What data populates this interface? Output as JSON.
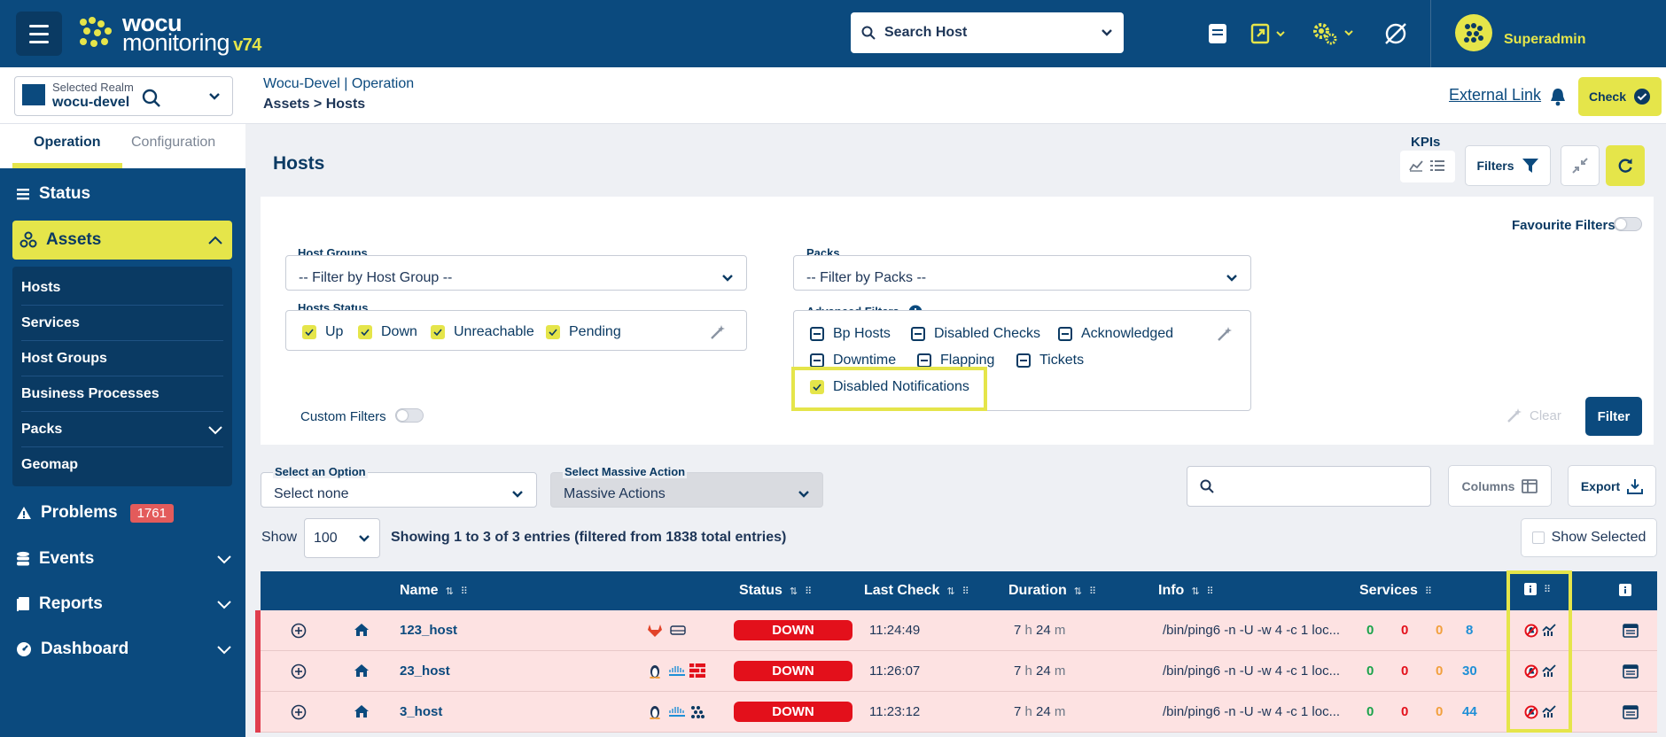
{
  "brand": {
    "line1": "wocu",
    "line2": "monitoring",
    "version": "v74"
  },
  "search_host": {
    "label": "Search Host"
  },
  "user": {
    "name": "Superadmin"
  },
  "realm": {
    "label": "Selected Realm",
    "value": "wocu-devel"
  },
  "breadcrumb": {
    "context": "Wocu-Devel | Operation",
    "path": "Assets > Hosts"
  },
  "header": {
    "external_link": "External Link",
    "check_label": "Check"
  },
  "sidebar": {
    "tabs": [
      "Operation",
      "Configuration"
    ],
    "items": [
      {
        "label": "Status"
      },
      {
        "label": "Assets"
      },
      {
        "label": "Problems",
        "badge": "1761"
      },
      {
        "label": "Events"
      },
      {
        "label": "Reports"
      },
      {
        "label": "Dashboard"
      }
    ],
    "assets_sub": [
      "Hosts",
      "Services",
      "Host Groups",
      "Business Processes",
      "Packs",
      "Geomap"
    ]
  },
  "page": {
    "title": "Hosts",
    "kpis": "KPIs",
    "filters": "Filters"
  },
  "filters": {
    "favourite": "Favourite Filters",
    "host_groups": {
      "label": "Host Groups",
      "placeholder": "-- Filter by Host Group --"
    },
    "packs": {
      "label": "Packs",
      "placeholder": "-- Filter by Packs --"
    },
    "hosts_status": {
      "label": "Hosts Status",
      "options": [
        "Up",
        "Down",
        "Unreachable",
        "Pending"
      ]
    },
    "advanced": {
      "label": "Advanced Filters",
      "options": [
        "Bp Hosts",
        "Disabled Checks",
        "Acknowledged",
        "Downtime",
        "Flapping",
        "Tickets",
        "Disabled Notifications"
      ]
    },
    "custom": "Custom Filters",
    "clear": "Clear",
    "filter": "Filter"
  },
  "toolbar": {
    "select_option_label": "Select an Option",
    "select_option_value": "Select none",
    "massive_label": "Select Massive Action",
    "massive_value": "Massive Actions",
    "columns": "Columns",
    "export": "Export",
    "show_label": "Show",
    "show_value": "100",
    "entries": "Showing 1 to 3 of 3 entries (filtered from 1838 total entries)",
    "show_selected": "Show Selected"
  },
  "table": {
    "columns": [
      "Name",
      "Status",
      "Last Check",
      "Duration",
      "Info",
      "Services"
    ],
    "rows": [
      {
        "name": "123_host",
        "status": "DOWN",
        "last_check": "11:24:49",
        "dur_h": "7",
        "dur_m": "24",
        "info": "/bin/ping6 -n -U -w 4 -c 1 loc...",
        "s0": "0",
        "s1": "0",
        "s2": "0",
        "s3": "8"
      },
      {
        "name": "23_host",
        "status": "DOWN",
        "last_check": "11:26:07",
        "dur_h": "7",
        "dur_m": "24",
        "info": "/bin/ping6 -n -U -w 4 -c 1 loc...",
        "s0": "0",
        "s1": "0",
        "s2": "0",
        "s3": "30"
      },
      {
        "name": "3_host",
        "status": "DOWN",
        "last_check": "11:23:12",
        "dur_h": "7",
        "dur_m": "24",
        "info": "/bin/ping6 -n -U -w 4 -c 1 loc...",
        "s0": "0",
        "s1": "0",
        "s2": "0",
        "s3": "44"
      }
    ],
    "h_unit": "h",
    "m_unit": "m"
  }
}
